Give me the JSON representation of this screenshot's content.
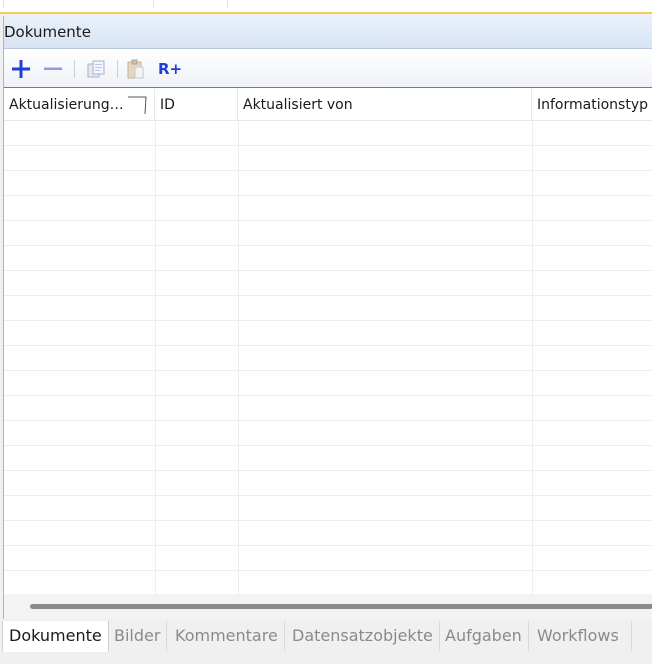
{
  "panel": {
    "title": "Dokumente"
  },
  "toolbar": {
    "add_icon": "plus-icon",
    "remove_icon": "minus-icon",
    "copy_icon": "copy-icon",
    "paste_icon": "paste-icon",
    "add_reference_label": "R+"
  },
  "grid": {
    "columns": [
      {
        "label": "Aktualisierung…",
        "filter_icon": "filter-icon"
      },
      {
        "label": "ID"
      },
      {
        "label": "Aktualisiert von"
      },
      {
        "label": "Informationstyp"
      }
    ],
    "rows": []
  },
  "tabs": [
    {
      "label": "Dokumente",
      "active": true
    },
    {
      "label": "Bilder",
      "active": false
    },
    {
      "label": "Kommentare",
      "active": false
    },
    {
      "label": "Datensatzobjekte",
      "active": false
    },
    {
      "label": "Aufgaben",
      "active": false
    },
    {
      "label": "Workflows",
      "active": false
    }
  ],
  "colors": {
    "accent_blue": "#1f3fd6",
    "header_gradient_top": "#eaf1fb",
    "header_gradient_bottom": "#d7e3f3",
    "top_strip_accent": "#f2cf5d"
  }
}
